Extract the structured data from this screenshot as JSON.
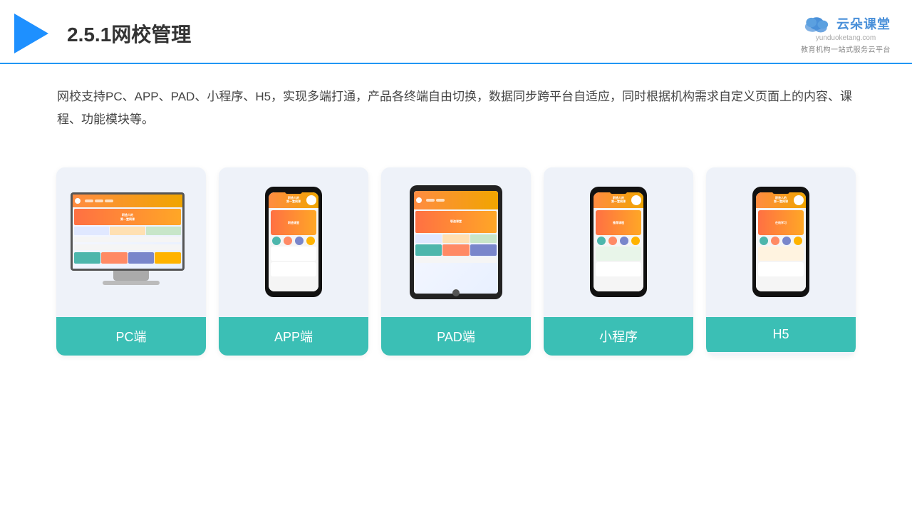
{
  "header": {
    "section_number": "2.5.1",
    "title": "网校管理",
    "logo": {
      "name": "云朵课堂",
      "url": "yunduoketang.com",
      "tagline": "教育机构一站式服务云平台"
    }
  },
  "description": {
    "text": "网校支持PC、APP、PAD、小程序、H5，实现多端打通，产品各终端自由切换，数据同步跨平台自适应，同时根据机构需求自定义页面上的内容、课程、功能模块等。"
  },
  "cards": [
    {
      "id": "pc",
      "label": "PC端"
    },
    {
      "id": "app",
      "label": "APP端"
    },
    {
      "id": "pad",
      "label": "PAD端"
    },
    {
      "id": "miniprogram",
      "label": "小程序"
    },
    {
      "id": "h5",
      "label": "H5"
    }
  ],
  "colors": {
    "accent_blue": "#1E90FF",
    "teal_label": "#3BBFB5",
    "header_border": "#2196F3",
    "card_bg": "#eef2f9"
  }
}
